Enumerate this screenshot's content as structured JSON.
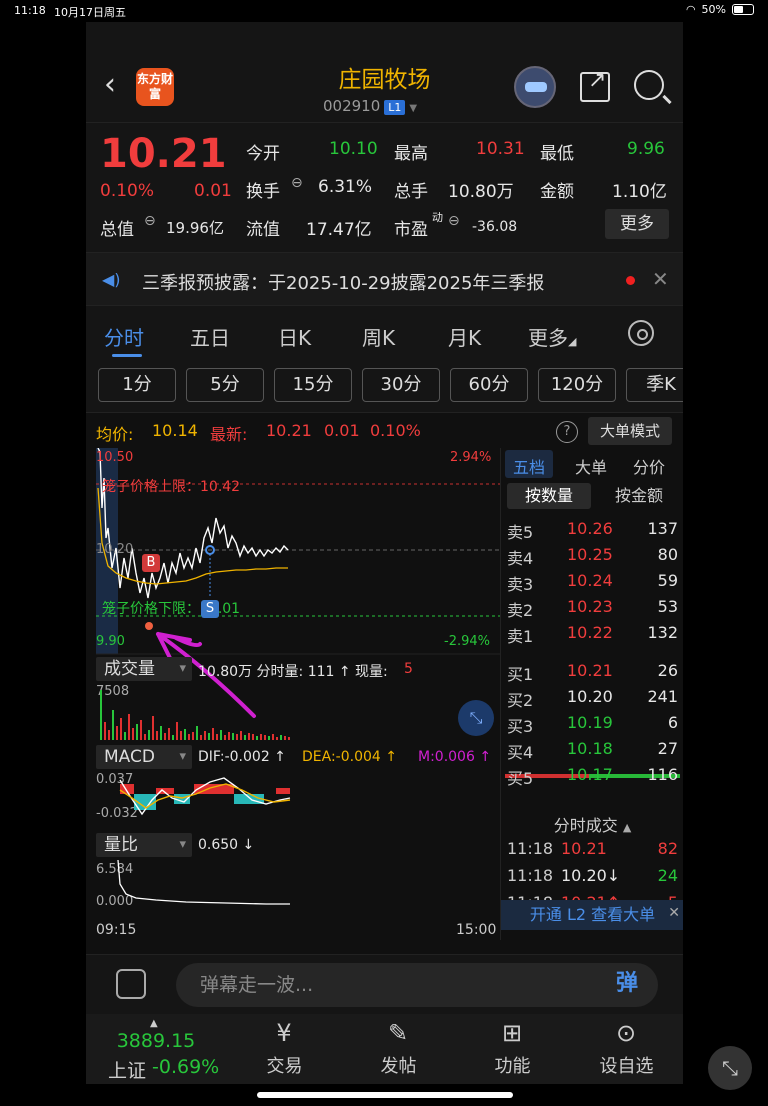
{
  "statusbar": {
    "time": "11:18",
    "date": "10月17日周五",
    "battery": "50%"
  },
  "header": {
    "logo": "东方财富",
    "title": "庄园牧场",
    "code": "002910",
    "level": "L1"
  },
  "quote": {
    "price": "10.21",
    "change_pct": "0.10%",
    "change": "0.01",
    "open_label": "今开",
    "open": "10.10",
    "high_label": "最高",
    "high": "10.31",
    "low_label": "最低",
    "low": "9.96",
    "turnover_label": "换手",
    "turnover": "6.31%",
    "volume_label": "总手",
    "volume": "10.80万",
    "amount_label": "金额",
    "amount": "1.10亿",
    "mcap_label": "总值",
    "mcap": "19.96亿",
    "float_label": "流值",
    "float": "17.47亿",
    "pe_label": "市盈",
    "pe_sup": "动",
    "pe": "-36.08",
    "more": "更多"
  },
  "notice": {
    "text": "三季报预披露：于2025-10-29披露2025年三季报"
  },
  "tabs": [
    "分时",
    "五日",
    "日K",
    "周K",
    "月K",
    "更多"
  ],
  "periods": [
    "1分",
    "5分",
    "15分",
    "30分",
    "60分",
    "120分",
    "季K"
  ],
  "info": {
    "avg_label": "均价:",
    "avg": "10.14",
    "latest_label": "最新:",
    "latest": "10.21",
    "latest_chg": "0.01",
    "latest_pct": "0.10%",
    "big_mode": "大单模式"
  },
  "chart": {
    "top_price": "10.50",
    "top_pct": "2.94%",
    "bottom_price": "9.90",
    "bottom_pct": "-2.94%",
    "upper_limit": "笼子价格上限：10.42",
    "lower_limit": "笼子价格下限：10.01",
    "prev_close": "10.20",
    "buy_marker": "B",
    "sell_marker": "S",
    "time_start": "09:15",
    "time_end": "15:00"
  },
  "volume_panel": {
    "selector": "成交量",
    "text": "10.80万 分时量: 111 ↑ 现量:",
    "current": "5",
    "max": "7508"
  },
  "macd_panel": {
    "selector": "MACD",
    "dif": "DIF:-0.002 ↑",
    "dea": "DEA:-0.004 ↑",
    "m": "M:0.006 ↑",
    "top": "0.037",
    "bottom": "-0.032"
  },
  "ratio_panel": {
    "selector": "量比",
    "value": "0.650 ↓",
    "top": "6.584",
    "bottom": "0.000"
  },
  "orderbook": {
    "tabs": [
      "五档",
      "大单",
      "分价"
    ],
    "subtabs": [
      "按数量",
      "按金额"
    ],
    "asks": [
      {
        "name": "卖5",
        "price": "10.26",
        "vol": "137"
      },
      {
        "name": "卖4",
        "price": "10.25",
        "vol": "80"
      },
      {
        "name": "卖3",
        "price": "10.24",
        "vol": "59"
      },
      {
        "name": "卖2",
        "price": "10.23",
        "vol": "53"
      },
      {
        "name": "卖1",
        "price": "10.22",
        "vol": "132"
      }
    ],
    "bids": [
      {
        "name": "买1",
        "price": "10.21",
        "vol": "26",
        "color": "red"
      },
      {
        "name": "买2",
        "price": "10.20",
        "vol": "241",
        "color": "white"
      },
      {
        "name": "买3",
        "price": "10.19",
        "vol": "6",
        "color": "green"
      },
      {
        "name": "买4",
        "price": "10.18",
        "vol": "27",
        "color": "green"
      },
      {
        "name": "买5",
        "price": "10.17",
        "vol": "116",
        "color": "green"
      }
    ],
    "trades_title": "分时成交",
    "trades": [
      {
        "time": "11:18",
        "price": "10.21",
        "vol": "82",
        "pc": "red",
        "vc": "red"
      },
      {
        "time": "11:18",
        "price": "10.20↓",
        "vol": "24",
        "pc": "white",
        "vc": "green"
      },
      {
        "time": "11:18",
        "price": "10.21↑",
        "vol": "5",
        "pc": "red",
        "vc": "red"
      }
    ],
    "l2": "开通 L2 查看大单"
  },
  "danmu": {
    "placeholder": "弹幕走一波...",
    "button": "弹"
  },
  "bottombar": {
    "index_value": "3889.15",
    "index_name": "上证",
    "index_pct": "-0.69%",
    "items": [
      "交易",
      "发帖",
      "功能",
      "设自选"
    ]
  }
}
